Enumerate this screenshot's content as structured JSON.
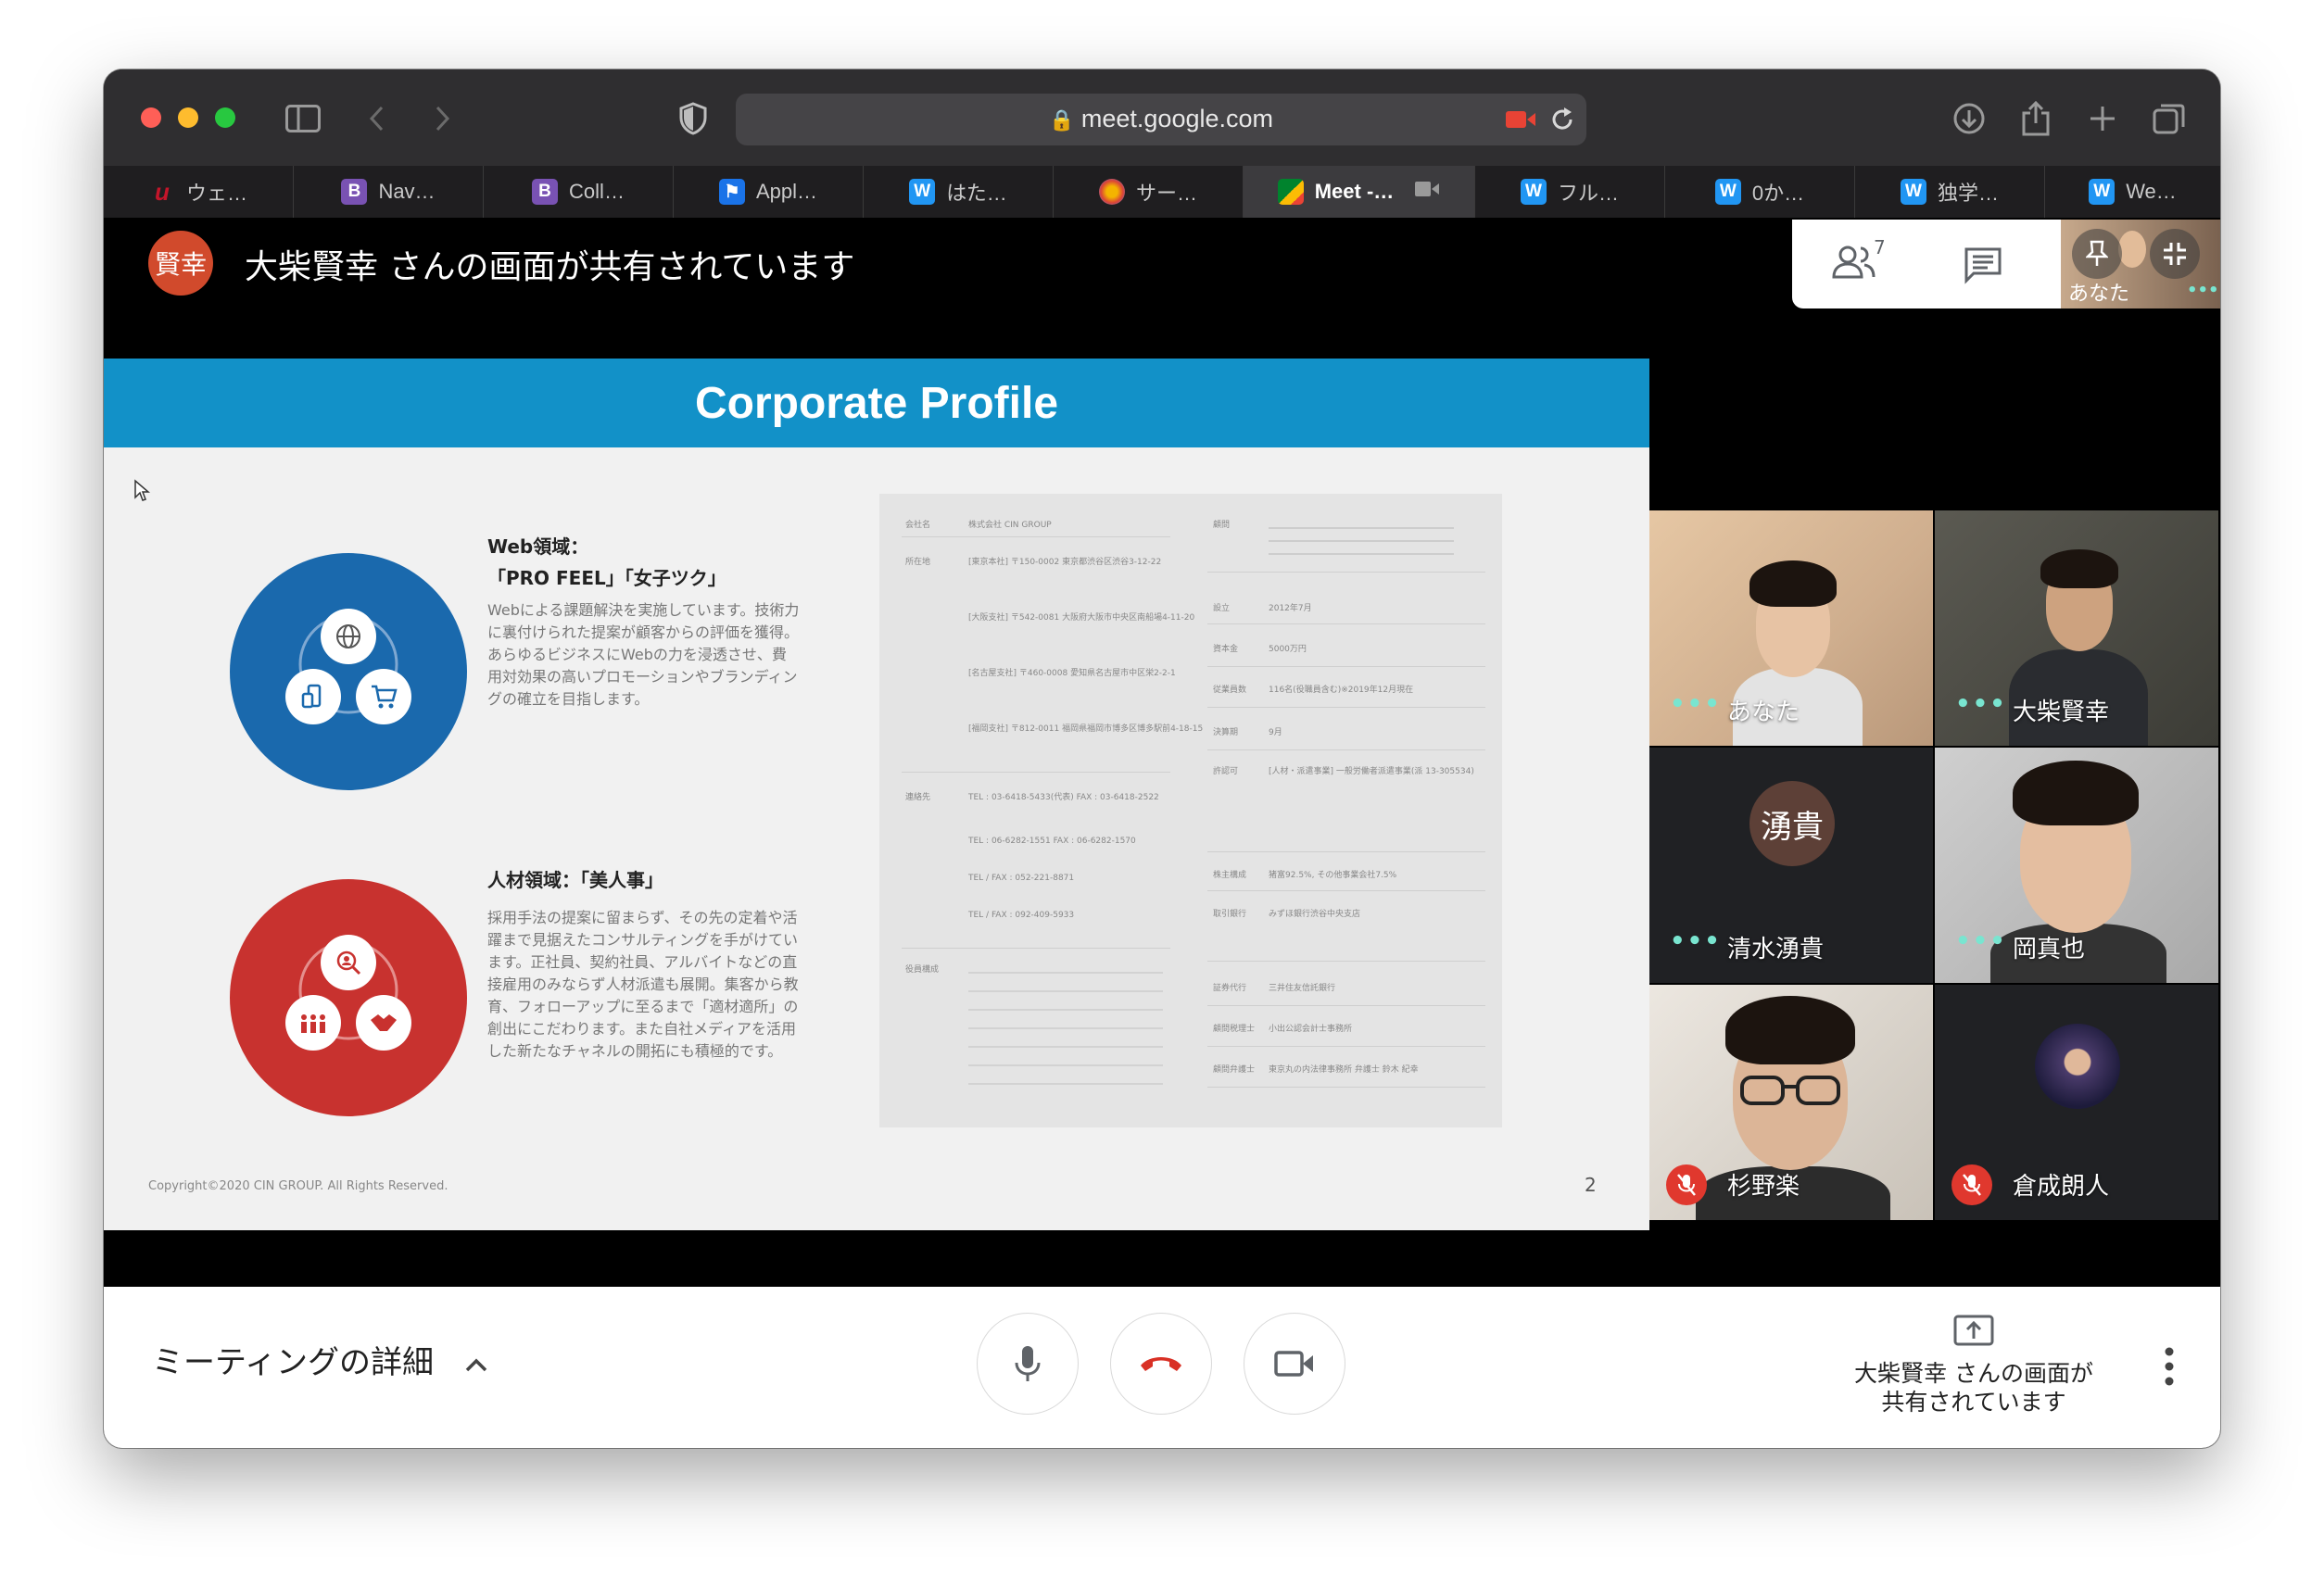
{
  "browser": {
    "url": "meet.google.com",
    "tabs": [
      {
        "label": "ウェ…",
        "icon": "u-icon",
        "color": "#c4152a"
      },
      {
        "label": "Nav…",
        "icon": "bootstrap-icon",
        "color": "#7952b3"
      },
      {
        "label": "Coll…",
        "icon": "bootstrap-icon",
        "color": "#7952b3"
      },
      {
        "label": "Appl…",
        "icon": "flag-icon",
        "color": "#1a73e8"
      },
      {
        "label": "はた…",
        "icon": "w-icon",
        "color": "#2196f3"
      },
      {
        "label": "サー…",
        "icon": "colorful-icon",
        "color": "#f4b400"
      },
      {
        "label": "Meet -…",
        "icon": "meet-icon",
        "color": "#00832d"
      },
      {
        "label": "フル…",
        "icon": "w-icon",
        "color": "#2196f3"
      },
      {
        "label": "0か…",
        "icon": "w-icon",
        "color": "#2196f3"
      },
      {
        "label": "独学…",
        "icon": "w-icon",
        "color": "#2196f3"
      },
      {
        "label": "We…",
        "icon": "w-icon",
        "color": "#2196f3"
      }
    ]
  },
  "meet": {
    "presenter_initials": "賢幸",
    "presenting_banner": "大柴賢幸 さんの画面が共有されています",
    "participant_count": "7",
    "self_tile_label": "あなた",
    "participants": [
      {
        "name": "あなた",
        "muted": false
      },
      {
        "name": "大柴賢幸",
        "muted": false
      },
      {
        "name": "清水湧貴",
        "muted": false,
        "avatar": "湧貴"
      },
      {
        "name": "岡真也",
        "muted": false
      },
      {
        "name": "杉野楽",
        "muted": true
      },
      {
        "name": "倉成朗人",
        "muted": true
      }
    ],
    "meeting_details": "ミーティングの詳細",
    "share_status_line1": "大柴賢幸 さんの画面が",
    "share_status_line2": "共有されています"
  },
  "slide": {
    "title": "Corporate Profile",
    "web_heading_1": "Web領域：",
    "web_heading_2": "「PRO FEEL」「女子ツク」",
    "web_body": "Webによる課題解決を実施しています。技術力に裏付けられた提案が顧客からの評価を獲得。あらゆるビジネスにWebの力を浸透させ、費用対効果の高いプロモーションやブランディングの確立を目指します。",
    "hr_heading": "人材領域：「美人事」",
    "hr_body": "採用手法の提案に留まらず、その先の定着や活躍まで見据えたコンサルティングを手がけています。正社員、契約社員、アルバイトなどの直接雇用のみならず人材派遣も展開。集客から教育、フォローアップに至るまで「適材適所」の創出にこだわります。また自社メディアを活用した新たなチャネルの開拓にも積極的です。",
    "copyright": "Copyright©2020 CIN GROUP. All Rights Reserved.",
    "page": "2",
    "doc_left": [
      "会社名",
      "所在地",
      "連絡先",
      "役員構成"
    ],
    "doc_right": [
      "顧問",
      "設立",
      "資本金",
      "従業員数",
      "決算期",
      "許認可",
      "株主構成",
      "取引銀行",
      "証券代行",
      "顧問税理士",
      "顧問弁護士"
    ],
    "doc_values_left": [
      "株式会社 CIN GROUP",
      "[東京本社] 〒150-0002 東京都渋谷区渋谷3-12-22",
      "[大阪支社] 〒542-0081 大阪府大阪市中央区南船場4-11-20",
      "[名古屋支社] 〒460-0008 愛知県名古屋市中区栄2-2-1",
      "[福岡支社] 〒812-0011 福岡県福岡市博多区博多駅前4-18-15",
      "TEL : 03-6418-5433(代表)  FAX : 03-6418-2522",
      "TEL : 06-6282-1551  FAX : 06-6282-1570",
      "TEL / FAX : 052-221-8871",
      "TEL / FAX : 092-409-5933"
    ],
    "doc_values_right": [
      "2012年7月",
      "5000万円",
      "116名(役職員含む)※2019年12月現在",
      "9月",
      "[人材・派遣事業] 一般労働者派遣事業(派 13-305534)",
      "猪富92.5%, その他事業会社7.5%",
      "みずほ銀行渋谷中央支店",
      "三井住友信託銀行",
      "小出公認会計士事務所",
      "東京丸の内法律事務所 弁護士 鈴木 紀幸"
    ]
  }
}
